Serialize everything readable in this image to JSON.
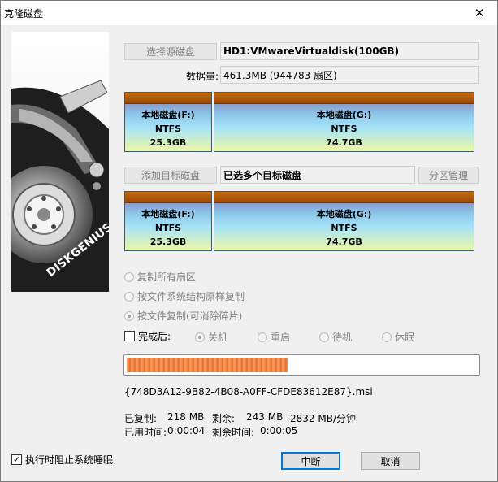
{
  "window": {
    "title": "克隆磁盘"
  },
  "source": {
    "button_label": "选择源磁盘",
    "disk_value": "HD1:VMwareVirtualdisk(100GB)",
    "data_label": "数据量:",
    "data_value": "461.3MB (944783 扇区)"
  },
  "source_partitions": [
    {
      "name": "本地磁盘(F:)",
      "fs": "NTFS",
      "size": "25.3GB"
    },
    {
      "name": "本地磁盘(G:)",
      "fs": "NTFS",
      "size": "74.7GB"
    }
  ],
  "target": {
    "add_button_label": "添加目标磁盘",
    "value": "已选多个目标磁盘",
    "partition_mgmt_label": "分区管理"
  },
  "target_partitions": [
    {
      "name": "本地磁盘(F:)",
      "fs": "NTFS",
      "size": "25.3GB"
    },
    {
      "name": "本地磁盘(G:)",
      "fs": "NTFS",
      "size": "74.7GB"
    }
  ],
  "copy_modes": [
    {
      "label": "复制所有扇区",
      "checked": false
    },
    {
      "label": "按文件系统结构原样复制",
      "checked": false
    },
    {
      "label": "按文件复制(可消除碎片)",
      "checked": true
    }
  ],
  "after_complete": {
    "label": "完成后:",
    "options": [
      "关机",
      "重启",
      "待机",
      "休眠"
    ],
    "selected": "关机"
  },
  "progress": {
    "fraction": 0.46
  },
  "current_file": "{748D3A12-9B82-4B08-A0FF-CFDE83612E87}.msi",
  "stats": {
    "copied_label": "已复制:",
    "copied_value": "218 MB",
    "remaining_label": "剩余:",
    "remaining_value": "243 MB",
    "speed": "2832 MB/分钟",
    "elapsed_label": "已用时间:",
    "elapsed_value": "0:00:04",
    "remaining_time_label": "剩余时间:",
    "remaining_time_value": "0:00:05"
  },
  "prevent_sleep": {
    "label": "执行时阻止系统睡眠",
    "checked": true
  },
  "buttons": {
    "interrupt": "中断",
    "cancel": "取消"
  },
  "illustration": {
    "brand_text": "DISKGENIUS"
  }
}
